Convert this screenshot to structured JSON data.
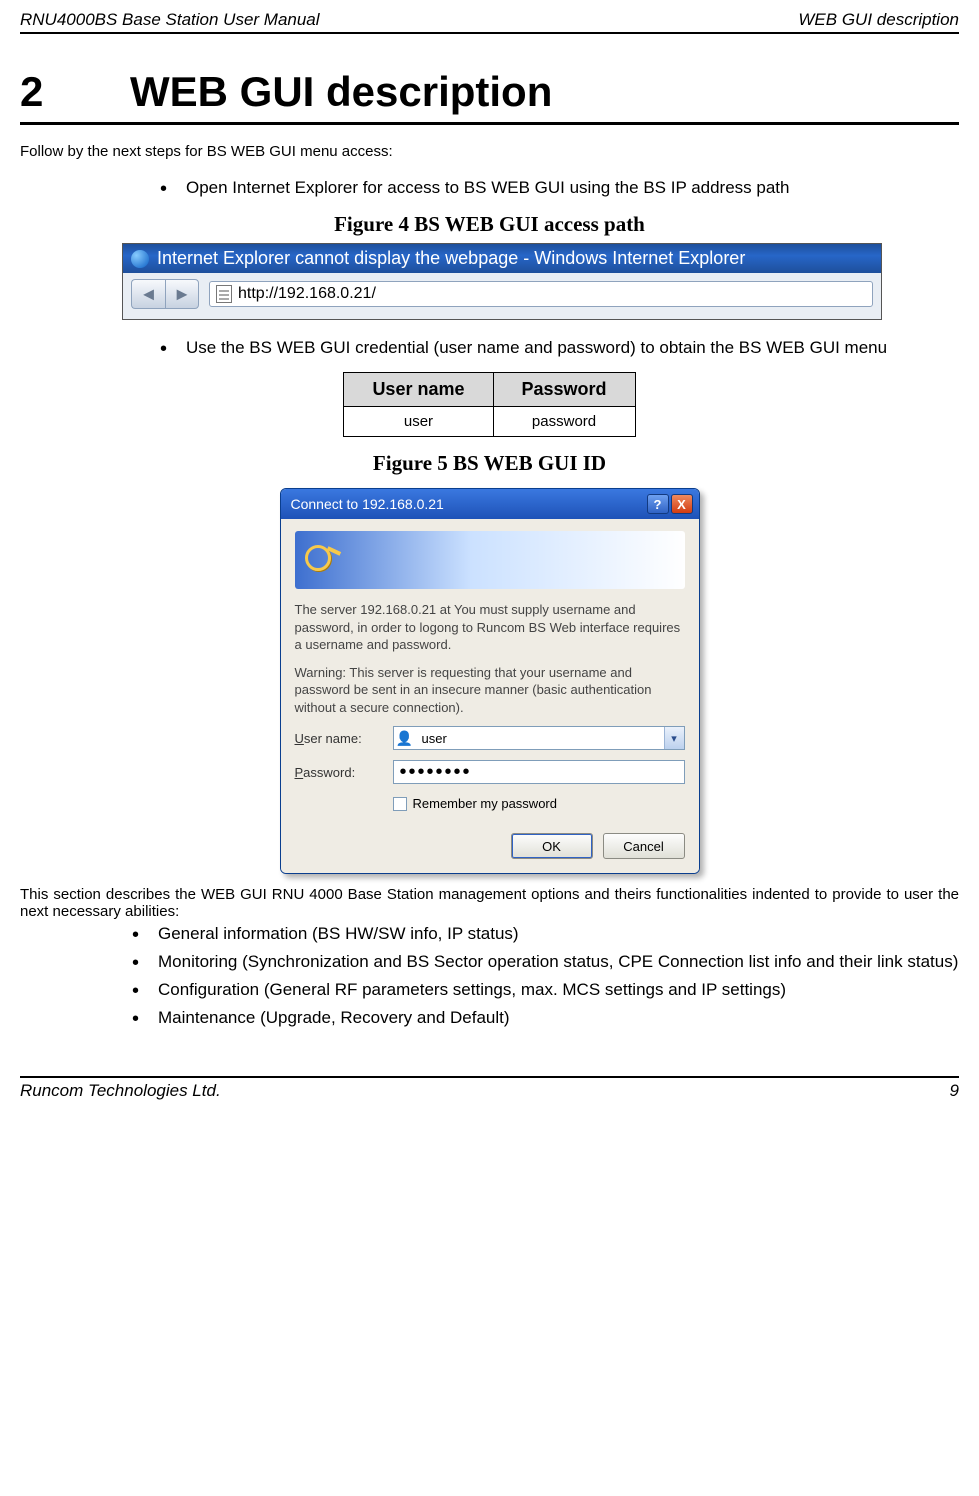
{
  "header": {
    "left": "RNU4000BS Base Station User Manual",
    "right": "WEB GUI description"
  },
  "chapter": {
    "number": "2",
    "title": "WEB GUI description"
  },
  "intro": "Follow by the next steps for BS WEB GUI menu access:",
  "steps": {
    "item1": "Open Internet Explorer for access to BS WEB GUI using the BS IP address path",
    "item2": "Use the BS WEB GUI credential (user name and password) to obtain the BS WEB GUI menu"
  },
  "figure4": {
    "caption": "Figure 4    BS WEB GUI access path",
    "window_title": "Internet Explorer cannot display the webpage - Windows Internet Explorer",
    "url": "http://192.168.0.21/"
  },
  "cred_table": {
    "h1": "User name",
    "h2": "Password",
    "v1": "user",
    "v2": "password"
  },
  "figure5": {
    "caption": "Figure 5    BS WEB GUI ID"
  },
  "dialog": {
    "title": "Connect to 192.168.0.21",
    "help": "?",
    "close": "X",
    "msg1": "The server 192.168.0.21 at You must supply username and password, in order to logong to Runcom BS Web interface requires a username and password.",
    "msg2": "Warning: This server is requesting that your username and password be sent in an insecure manner (basic authentication without a secure connection).",
    "label_user_pre": "U",
    "label_user_rest": "ser name:",
    "label_pass_pre": "P",
    "label_pass_rest": "assword:",
    "user_value": "user",
    "pass_mask": "••••••••",
    "remember": "Remember my password",
    "ok": "OK",
    "cancel": "Cancel"
  },
  "section_para": "This section describes the WEB GUI RNU 4000 Base Station management options and theirs functionalities indented to provide to user the next necessary abilities:",
  "abilities": {
    "a1": "General information (BS HW/SW info, IP status)",
    "a2": "Monitoring (Synchronization and BS Sector operation status, CPE Connection list info and their link status)",
    "a3": "Configuration (General RF parameters settings, max. MCS settings and IP settings)",
    "a4": "Maintenance (Upgrade, Recovery and Default)"
  },
  "footer": {
    "left": "Runcom Technologies Ltd.",
    "right": "9"
  }
}
